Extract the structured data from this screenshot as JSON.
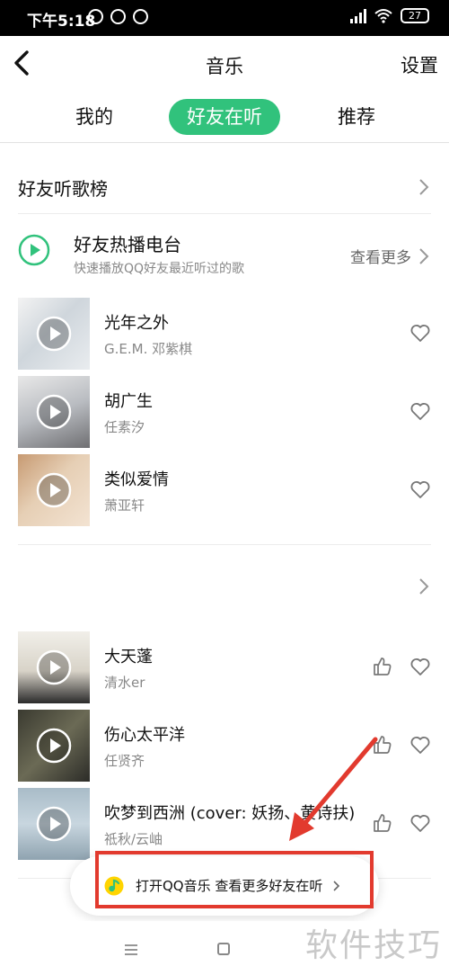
{
  "status": {
    "time": "下午5:18",
    "battery": "27"
  },
  "header": {
    "title": "音乐",
    "settings_label": "设置"
  },
  "tabs": [
    {
      "label": "我的"
    },
    {
      "label": "好友在听"
    },
    {
      "label": "推荐"
    }
  ],
  "rank": {
    "label": "好友听歌榜"
  },
  "radio": {
    "title": "好友热播电台",
    "subtitle": "快速播放QQ好友最近听过的歌",
    "more_label": "查看更多"
  },
  "songs_a": [
    {
      "name": "光年之外",
      "artist": "G.E.M. 邓紫棋"
    },
    {
      "name": "胡广生",
      "artist": "任素汐"
    },
    {
      "name": "类似爱情",
      "artist": "萧亚轩"
    }
  ],
  "songs_b": [
    {
      "name": "大天蓬",
      "artist": "清水er"
    },
    {
      "name": "伤心太平洋",
      "artist": "任贤齐"
    },
    {
      "name": "吹梦到西洲 (cover: 妖扬、黄诗扶)",
      "artist": "祗秋/云岫"
    }
  ],
  "promo": {
    "text": "打开QQ音乐 查看更多好友在听"
  },
  "watermark": "软件技巧",
  "colors": {
    "accent": "#31c27c",
    "annotation": "#e23a2e"
  }
}
